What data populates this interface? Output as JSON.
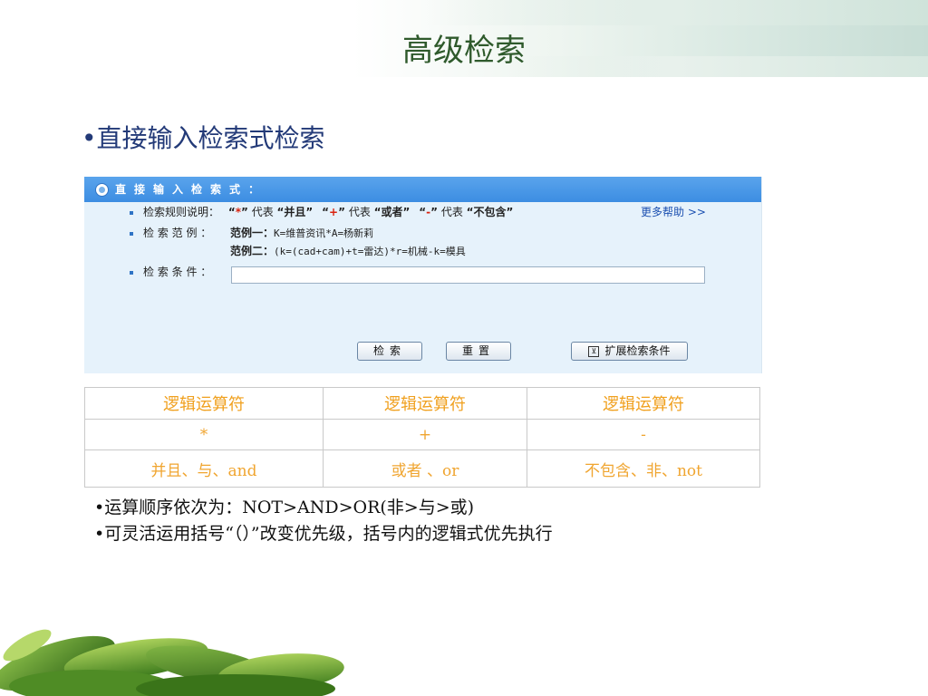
{
  "title": "高级检索",
  "heading": "•直接输入检索式检索",
  "panel": {
    "header": "直接输入检索式：",
    "rules_label": "检索规则说明：",
    "rules": [
      {
        "open": "“",
        "op": "*",
        "close": "”",
        "word": " 代表 ",
        "meaning": "“并且”"
      },
      {
        "open": "“",
        "op": "+",
        "close": "”",
        "word": " 代表 ",
        "meaning": "“或者”"
      },
      {
        "open": "“",
        "op": "-",
        "close": "”",
        "word": " 代表 ",
        "meaning": "“不包含”"
      }
    ],
    "more_help": "更多帮助 >>",
    "example_label": "检 索 范 例 ：",
    "example1_label": "范例一：",
    "example1_value": "K=维普资讯*A=杨新莉",
    "example2_label": "范例二：",
    "example2_value": "(k=(cad+cam)+t=雷达)*r=机械-k=模具",
    "condition_label": "检 索 条 件 ：",
    "condition_value": "",
    "search_button": "检索",
    "reset_button": "重置",
    "expand_icon": "⊻",
    "expand_button": "扩展检索条件"
  },
  "table": {
    "headers": [
      "逻辑运算符",
      "逻辑运算符",
      "逻辑运算符"
    ],
    "symbols": [
      "*",
      "+",
      "-"
    ],
    "meanings": [
      "并且、与、and",
      "或者 、or",
      "不包含、非、not"
    ]
  },
  "notes": [
    "•运算顺序依次为：NOT>AND>OR(非>与>或)",
    "•可灵活运用括号“（）”改变优先级，括号内的逻辑式优先执行"
  ],
  "colors": {
    "title": "#2f5a2c",
    "heading": "#233a78",
    "panel_header": "#3c8de2",
    "table_text": "#f0a530"
  }
}
